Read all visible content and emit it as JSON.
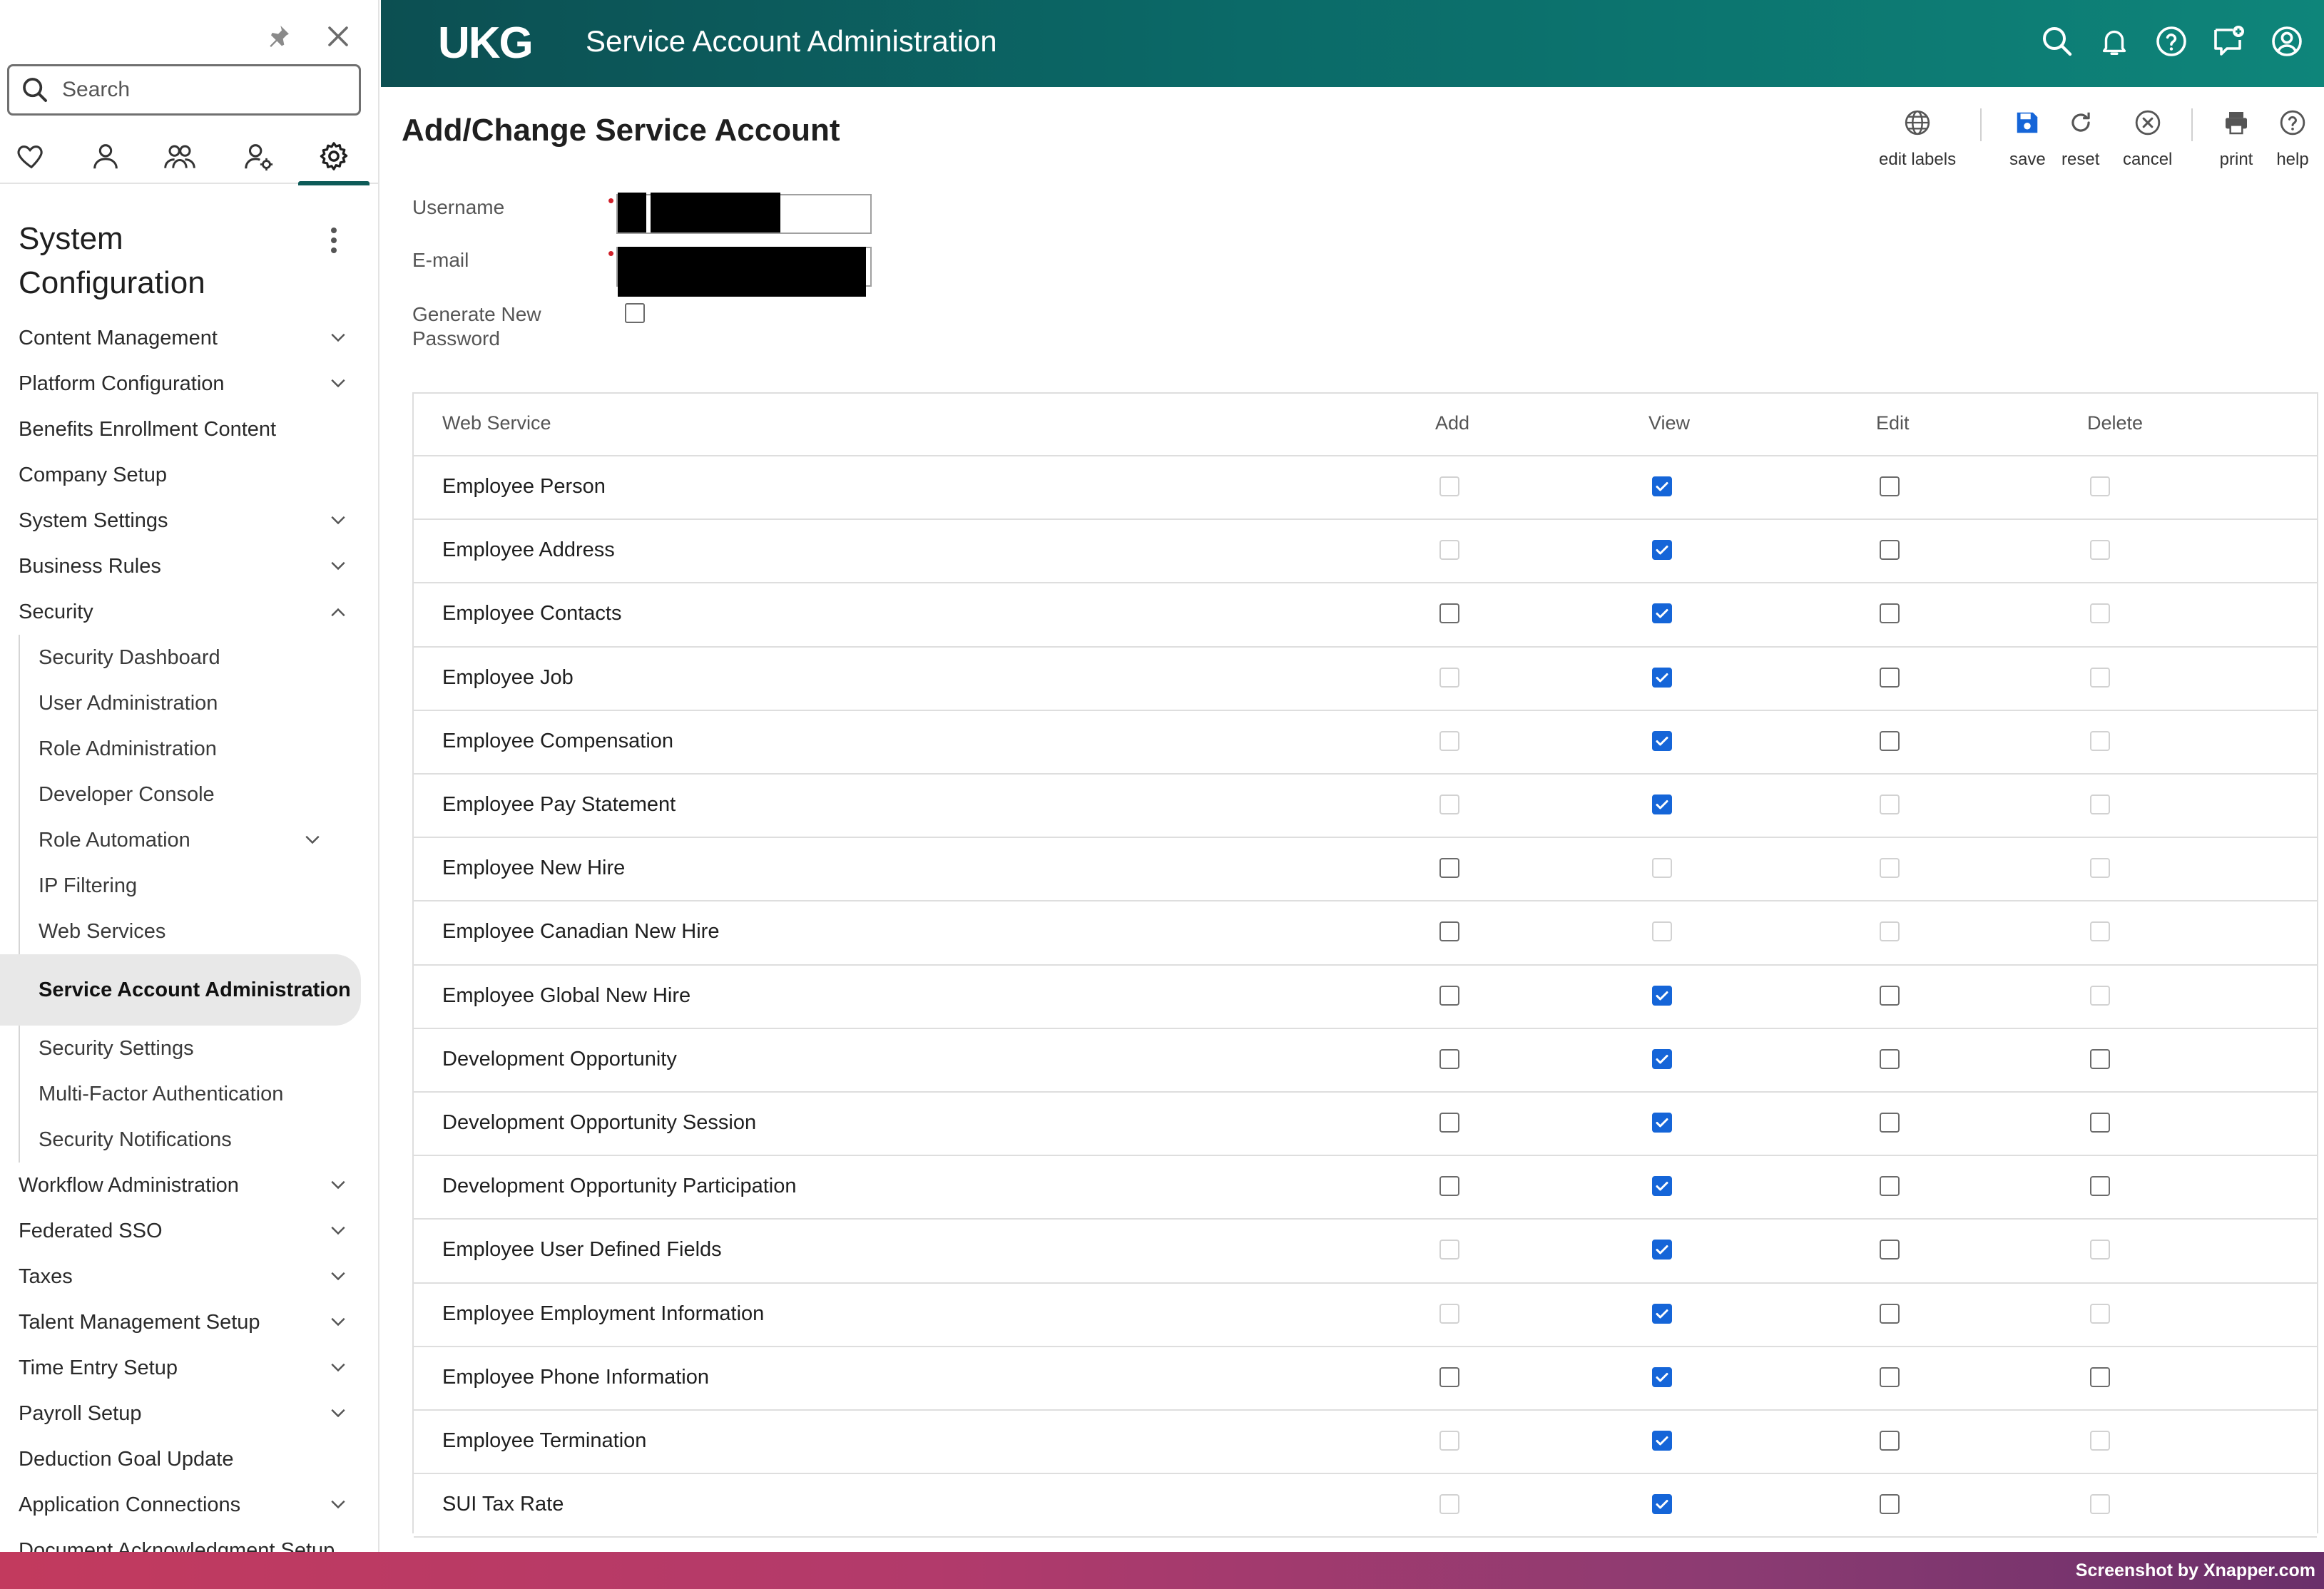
{
  "sidebar": {
    "search_placeholder": "Search",
    "title": "System Configuration",
    "menu": [
      {
        "label": "Content Management",
        "expandable": true
      },
      {
        "label": "Platform Configuration",
        "expandable": true
      },
      {
        "label": "Benefits Enrollment Content",
        "expandable": false
      },
      {
        "label": "Company Setup",
        "expandable": false
      },
      {
        "label": "System Settings",
        "expandable": true
      },
      {
        "label": "Business Rules",
        "expandable": true
      },
      {
        "label": "Security",
        "expandable": true,
        "expanded": true
      }
    ],
    "security_items": [
      {
        "label": "Security Dashboard"
      },
      {
        "label": "User Administration"
      },
      {
        "label": "Role Administration"
      },
      {
        "label": "Developer Console"
      },
      {
        "label": "Role Automation",
        "expandable": true
      },
      {
        "label": "IP Filtering"
      },
      {
        "label": "Web Services"
      },
      {
        "label": "Service Account Administration",
        "active": true
      },
      {
        "label": "Security Settings"
      },
      {
        "label": "Multi-Factor Authentication"
      },
      {
        "label": "Security Notifications"
      }
    ],
    "menu_after": [
      {
        "label": "Workflow Administration",
        "expandable": true
      },
      {
        "label": "Federated SSO",
        "expandable": true
      },
      {
        "label": "Taxes",
        "expandable": true
      },
      {
        "label": "Talent Management Setup",
        "expandable": true
      },
      {
        "label": "Time Entry Setup",
        "expandable": true
      },
      {
        "label": "Payroll Setup",
        "expandable": true
      },
      {
        "label": "Deduction Goal Update",
        "expandable": false
      },
      {
        "label": "Application Connections",
        "expandable": true
      },
      {
        "label": "Document Acknowledgment Setup",
        "expandable": false
      }
    ]
  },
  "header": {
    "logo": "UKG",
    "title": "Service Account Administration",
    "icons": [
      "search-icon",
      "bell-icon",
      "help-icon",
      "chat-add-icon",
      "user-icon"
    ]
  },
  "page": {
    "title": "Add/Change Service Account",
    "toolbar": {
      "edit_labels": "edit labels",
      "save": "save",
      "reset": "reset",
      "cancel": "cancel",
      "print": "print",
      "help": "help"
    },
    "form": {
      "username_label": "Username",
      "email_label": "E-mail",
      "generate_password_label": "Generate New Password",
      "generate_password_checked": false
    }
  },
  "table": {
    "headers": [
      "Web Service",
      "Add",
      "View",
      "Edit",
      "Delete"
    ],
    "rows": [
      {
        "name": "Employee Person",
        "add": "disabled",
        "view": "checked",
        "edit": "unchecked",
        "delete": "disabled"
      },
      {
        "name": "Employee Address",
        "add": "disabled",
        "view": "checked",
        "edit": "unchecked",
        "delete": "disabled"
      },
      {
        "name": "Employee Contacts",
        "add": "unchecked",
        "view": "checked",
        "edit": "unchecked",
        "delete": "disabled"
      },
      {
        "name": "Employee Job",
        "add": "disabled",
        "view": "checked",
        "edit": "unchecked",
        "delete": "disabled"
      },
      {
        "name": "Employee Compensation",
        "add": "disabled",
        "view": "checked",
        "edit": "unchecked",
        "delete": "disabled"
      },
      {
        "name": "Employee Pay Statement",
        "add": "disabled",
        "view": "checked",
        "edit": "disabled",
        "delete": "disabled"
      },
      {
        "name": "Employee New Hire",
        "add": "unchecked",
        "view": "disabled",
        "edit": "disabled",
        "delete": "disabled"
      },
      {
        "name": "Employee Canadian New Hire",
        "add": "unchecked",
        "view": "disabled",
        "edit": "disabled",
        "delete": "disabled"
      },
      {
        "name": "Employee Global New Hire",
        "add": "unchecked",
        "view": "checked",
        "edit": "unchecked",
        "delete": "disabled"
      },
      {
        "name": "Development Opportunity",
        "add": "unchecked",
        "view": "checked",
        "edit": "unchecked",
        "delete": "unchecked"
      },
      {
        "name": "Development Opportunity Session",
        "add": "unchecked",
        "view": "checked",
        "edit": "unchecked",
        "delete": "unchecked"
      },
      {
        "name": "Development Opportunity Participation",
        "add": "unchecked",
        "view": "checked",
        "edit": "unchecked",
        "delete": "unchecked"
      },
      {
        "name": "Employee User Defined Fields",
        "add": "disabled",
        "view": "checked",
        "edit": "unchecked",
        "delete": "disabled"
      },
      {
        "name": "Employee Employment Information",
        "add": "disabled",
        "view": "checked",
        "edit": "unchecked",
        "delete": "disabled"
      },
      {
        "name": "Employee Phone Information",
        "add": "unchecked",
        "view": "checked",
        "edit": "unchecked",
        "delete": "unchecked"
      },
      {
        "name": "Employee Termination",
        "add": "disabled",
        "view": "checked",
        "edit": "unchecked",
        "delete": "disabled"
      },
      {
        "name": "SUI Tax Rate",
        "add": "disabled",
        "view": "checked",
        "edit": "unchecked",
        "delete": "disabled"
      }
    ]
  },
  "footer": {
    "watermark": "Screenshot by Xnapper.com"
  },
  "colors": {
    "accent": "#0b6a68",
    "checkbox_checked": "#1565d8",
    "required_marker": "#d0202a"
  }
}
